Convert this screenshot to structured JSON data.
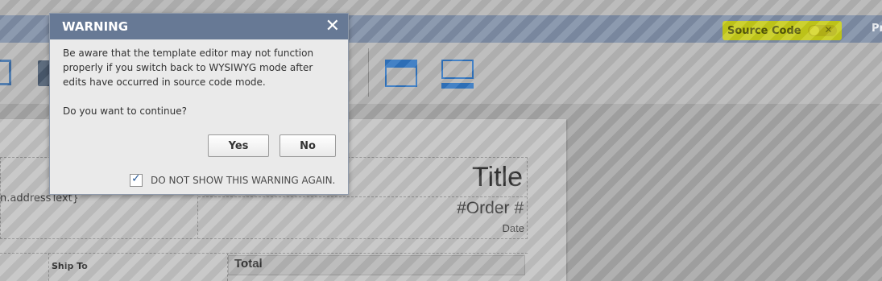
{
  "header": {
    "source_code_label": "Source Code",
    "right_text": "Pr"
  },
  "document": {
    "address_text": "n.addressText}",
    "title": "Title",
    "order": "#Order #",
    "date": "Date",
    "ship_to": "Ship To",
    "total": "Total"
  },
  "dialog": {
    "title": "WARNING",
    "close_glyph": "✕",
    "message": "Be aware that the template editor may not function properly if you switch back to WYSIWYG mode after edits have occurred in source code mode.",
    "question": "Do you want to continue?",
    "yes_label": "Yes",
    "no_label": "No",
    "dont_show_label": "DO NOT SHOW THIS WARNING AGAIN.",
    "dont_show_checked": true
  },
  "colors": {
    "header": "#7f8ea6",
    "dialog_titlebar": "#677995",
    "accent_blue": "#2f74c0",
    "highlight": "#c6cc1a"
  },
  "icons": [
    "close-icon",
    "checkbox-icon",
    "layout-icon"
  ]
}
